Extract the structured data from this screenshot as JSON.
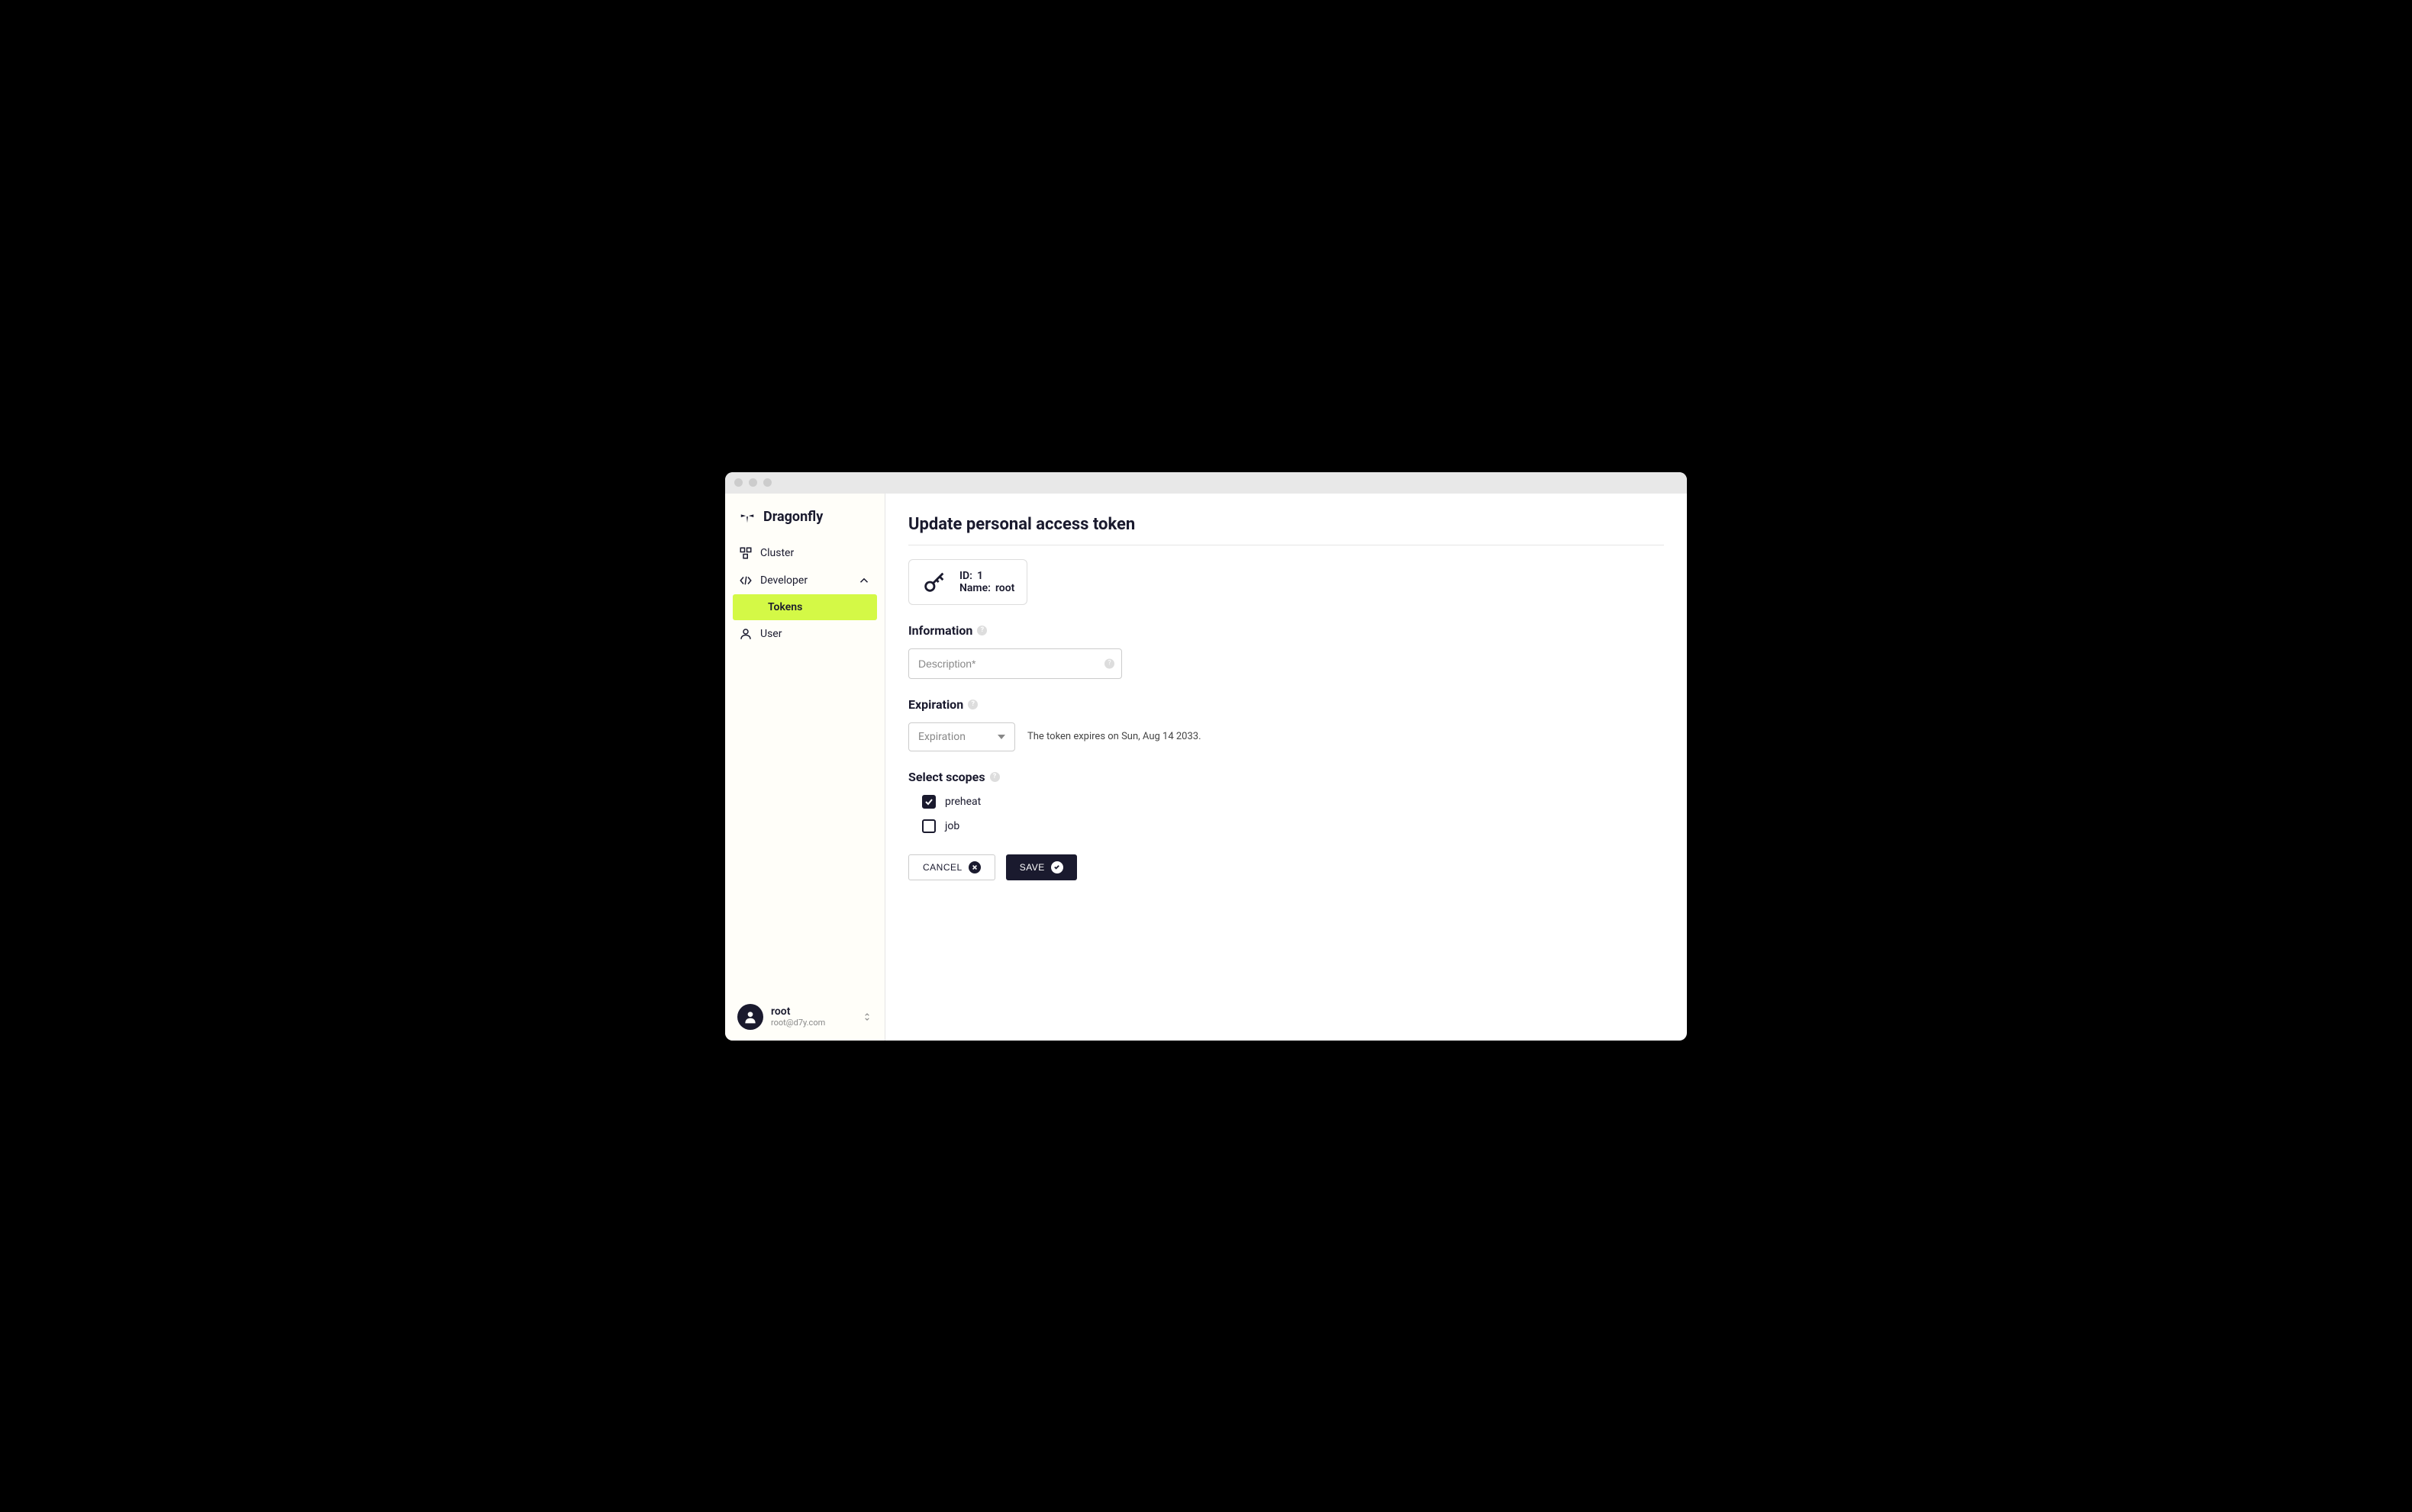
{
  "brand": "Dragonfly",
  "sidebar": {
    "cluster": "Cluster",
    "developer": "Developer",
    "tokens": "Tokens",
    "user": "User"
  },
  "user_footer": {
    "name": "root",
    "email": "root@d7y.com"
  },
  "page": {
    "title": "Update personal access token",
    "token": {
      "id_label": "ID:",
      "id_value": "1",
      "name_label": "Name:",
      "name_value": "root"
    },
    "sections": {
      "information": "Information",
      "expiration": "Expiration",
      "scopes": "Select scopes"
    },
    "description_placeholder": "Description*",
    "expiration_select": "Expiration",
    "expiration_text": "The token expires on Sun, Aug 14 2033.",
    "scope_items": {
      "preheat": "preheat",
      "job": "job"
    },
    "buttons": {
      "cancel": "CANCEL",
      "save": "SAVE"
    }
  }
}
